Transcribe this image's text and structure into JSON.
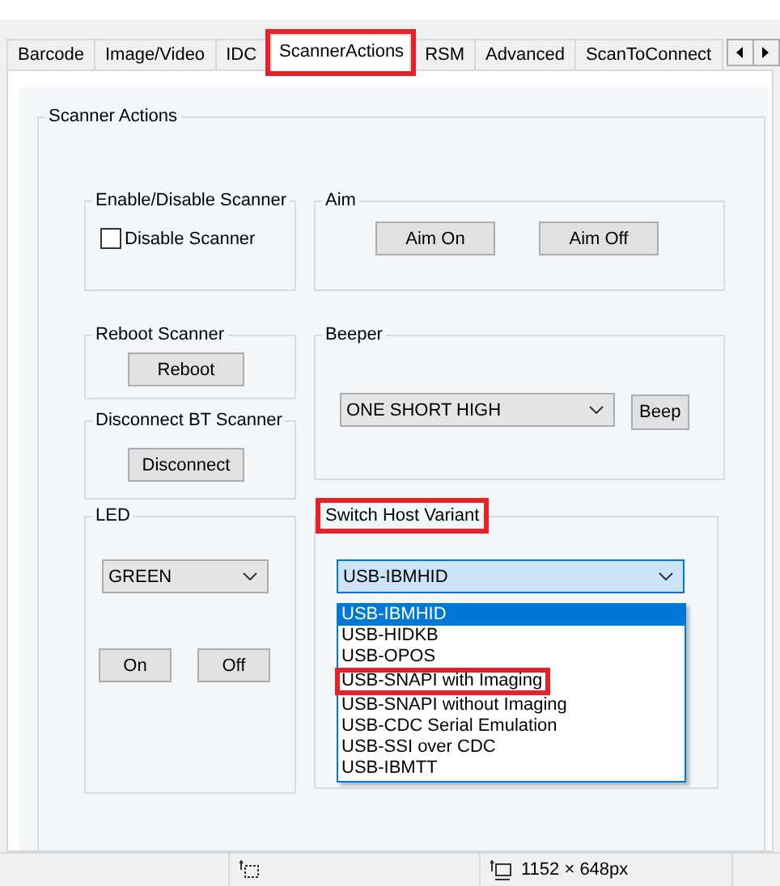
{
  "tabs": [
    {
      "label": "Barcode",
      "selected": false,
      "highlighted": false
    },
    {
      "label": "Image/Video",
      "selected": false,
      "highlighted": false
    },
    {
      "label": "IDC",
      "selected": false,
      "highlighted": false
    },
    {
      "label": "ScannerActions",
      "selected": true,
      "highlighted": true
    },
    {
      "label": "RSM",
      "selected": false,
      "highlighted": false
    },
    {
      "label": "Advanced",
      "selected": false,
      "highlighted": false
    },
    {
      "label": "ScanToConnect",
      "selected": false,
      "highlighted": false
    }
  ],
  "group": {
    "title": "Scanner Actions"
  },
  "enable_disable": {
    "title": "Enable/Disable Scanner",
    "checkbox": {
      "label": "Disable Scanner",
      "checked": false
    }
  },
  "aim": {
    "title": "Aim",
    "buttons": [
      "Aim On",
      "Aim Off"
    ]
  },
  "reboot": {
    "title": "Reboot Scanner",
    "button": "Reboot"
  },
  "disconnect": {
    "title": "Disconnect BT Scanner",
    "button": "Disconnect"
  },
  "beeper": {
    "title": "Beeper",
    "combo": {
      "value": "ONE SHORT HIGH"
    },
    "button": "Beep"
  },
  "led": {
    "title": "LED",
    "combo": {
      "value": "GREEN"
    },
    "buttons": [
      "On",
      "Off"
    ]
  },
  "host_variant": {
    "title": "Switch Host Variant",
    "highlighted": true,
    "combo": {
      "value": "USB-IBMHID",
      "expanded": true
    },
    "options": [
      {
        "label": "USB-IBMHID",
        "selected": true,
        "highlighted": false
      },
      {
        "label": "USB-HIDKB",
        "selected": false,
        "highlighted": false
      },
      {
        "label": "USB-OPOS",
        "selected": false,
        "highlighted": false
      },
      {
        "label": "USB-SNAPI with Imaging",
        "selected": false,
        "highlighted": true
      },
      {
        "label": "USB-SNAPI without Imaging",
        "selected": false,
        "highlighted": false
      },
      {
        "label": "USB-CDC Serial Emulation",
        "selected": false,
        "highlighted": false
      },
      {
        "label": "USB-SSI over CDC",
        "selected": false,
        "highlighted": false
      },
      {
        "label": "USB-IBMTT",
        "selected": false,
        "highlighted": false
      }
    ]
  },
  "status_bar": {
    "size": "1152 × 648px"
  }
}
